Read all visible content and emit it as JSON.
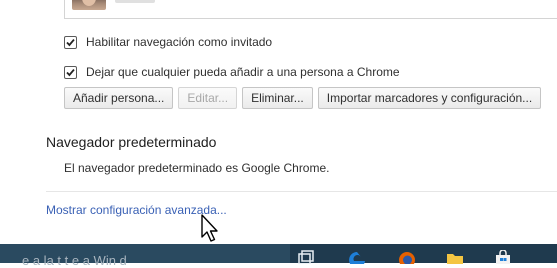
{
  "profiles": {
    "avatar_icon": "user-avatar"
  },
  "options": {
    "guest_browsing_label": "Habilitar navegación como invitado",
    "guest_browsing_checked": true,
    "add_person_label": "Dejar que cualquier pueda añadir a una persona a Chrome",
    "add_person_checked": true
  },
  "buttons": {
    "add_person": "Añadir persona...",
    "edit": "Editar...",
    "delete": "Eliminar...",
    "import": "Importar marcadores y configuración..."
  },
  "default_browser": {
    "title": "Navegador predeterminado",
    "status": "El navegador predeterminado es Google Chrome."
  },
  "advanced_link": "Mostrar configuración avanzada...",
  "taskbar": {
    "search_text": "e a la   t     t e a  Win  d",
    "icons": [
      "task-view-icon",
      "edge-icon",
      "firefox-icon",
      "file-explorer-icon",
      "store-icon"
    ],
    "colors": {
      "taskbar": "#1f3a4e",
      "search": "#2a4a60",
      "link": "#3a61b5"
    }
  }
}
